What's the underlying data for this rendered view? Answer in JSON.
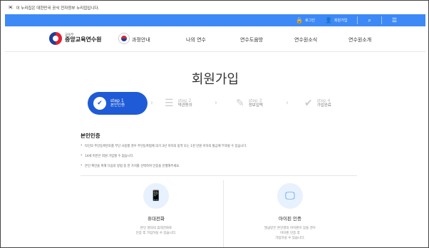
{
  "gov_banner": {
    "flag": "🇰🇷",
    "text": "이 누리집은 대한민국 공식 전자정부 누리집입니다."
  },
  "topbar": {
    "login": "로그인",
    "signup": "회원가입"
  },
  "logo": {
    "sub": "교육부",
    "name": "중앙교육연수원"
  },
  "nav": [
    "과정안내",
    "나의 연수",
    "연수도움방",
    "연수원소식",
    "연수원소개"
  ],
  "page": {
    "title": "회원가입"
  },
  "steps": [
    {
      "step": "step 1",
      "label": "본인인증",
      "active": true
    },
    {
      "step": "step 2",
      "label": "약관동의",
      "active": false
    },
    {
      "step": "step 3",
      "label": "정보입력",
      "active": false
    },
    {
      "step": "step 4",
      "label": "가입완료",
      "active": false
    }
  ],
  "section": {
    "title": "본인인증",
    "notes": [
      "타인의 주민등록번호를 무단 사용할 경우 주민등록법에 의거 3년 이하의 징역 또는 1천 만원 이하의 벌금에 부과될 수 있습니다.",
      "14세 미만은 회원 가입할 수 없습니다.",
      "본인 확인을 위해 다음의 방법 중 한 가지를 선택하여 인증을 진행해주세요."
    ]
  },
  "cards": [
    {
      "icon": "mobile-phone-icon",
      "title": "휴대전화",
      "desc1": "본인 명의의 휴대전화로",
      "desc2": "인증 후 가입하실 수 있습니다.",
      "desc3": ""
    },
    {
      "icon": "ipin-icon",
      "title": "아이핀 인증",
      "desc1": "발급받은 본인명의 아이핀이 있을 경우",
      "desc2": "아이핀 인증 후",
      "desc3": "가입하실 수 있습니다."
    }
  ],
  "colors": {
    "primary": "#1f5bd6",
    "topbar": "#3d8af7"
  }
}
